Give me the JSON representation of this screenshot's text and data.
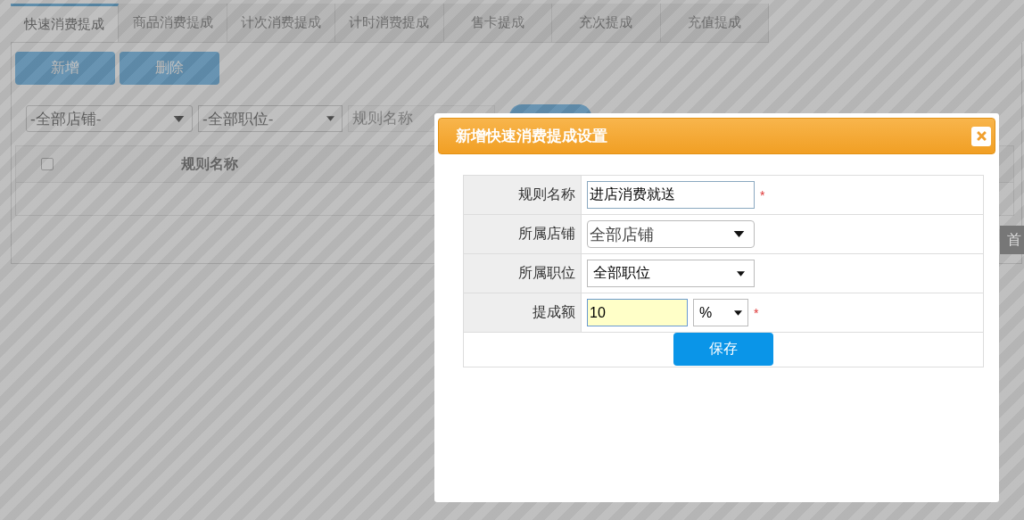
{
  "tabs": [
    {
      "label": "快速消费提成",
      "selected": true
    },
    {
      "label": "商品消费提成",
      "selected": false
    },
    {
      "label": "计次消费提成",
      "selected": false
    },
    {
      "label": "计时消费提成",
      "selected": false
    },
    {
      "label": "售卡提成",
      "selected": false
    },
    {
      "label": "充次提成",
      "selected": false
    },
    {
      "label": "充值提成",
      "selected": false
    }
  ],
  "toolbar_buttons": [
    "新增",
    "删除"
  ],
  "filters": {
    "shop_select": "-全部店铺-",
    "position_select": "-全部职位-",
    "rule_name_placeholder": "规则名称"
  },
  "table": {
    "select_all_checked": false,
    "columns": [
      "规则名称"
    ]
  },
  "side_tab": "首",
  "dialog": {
    "title": "新增快速消费提成设置",
    "fields": [
      {
        "kind": "text",
        "label": "规则名称",
        "value": "进店消费就送",
        "required_mark": "*"
      },
      {
        "kind": "select",
        "label": "所属店铺",
        "value": "全部店铺"
      },
      {
        "kind": "select",
        "label": "所属职位",
        "value": "全部职位"
      },
      {
        "kind": "amount",
        "label": "提成额",
        "value": "10",
        "unit": "%",
        "required_mark": "*"
      }
    ],
    "save_button": "保存"
  }
}
